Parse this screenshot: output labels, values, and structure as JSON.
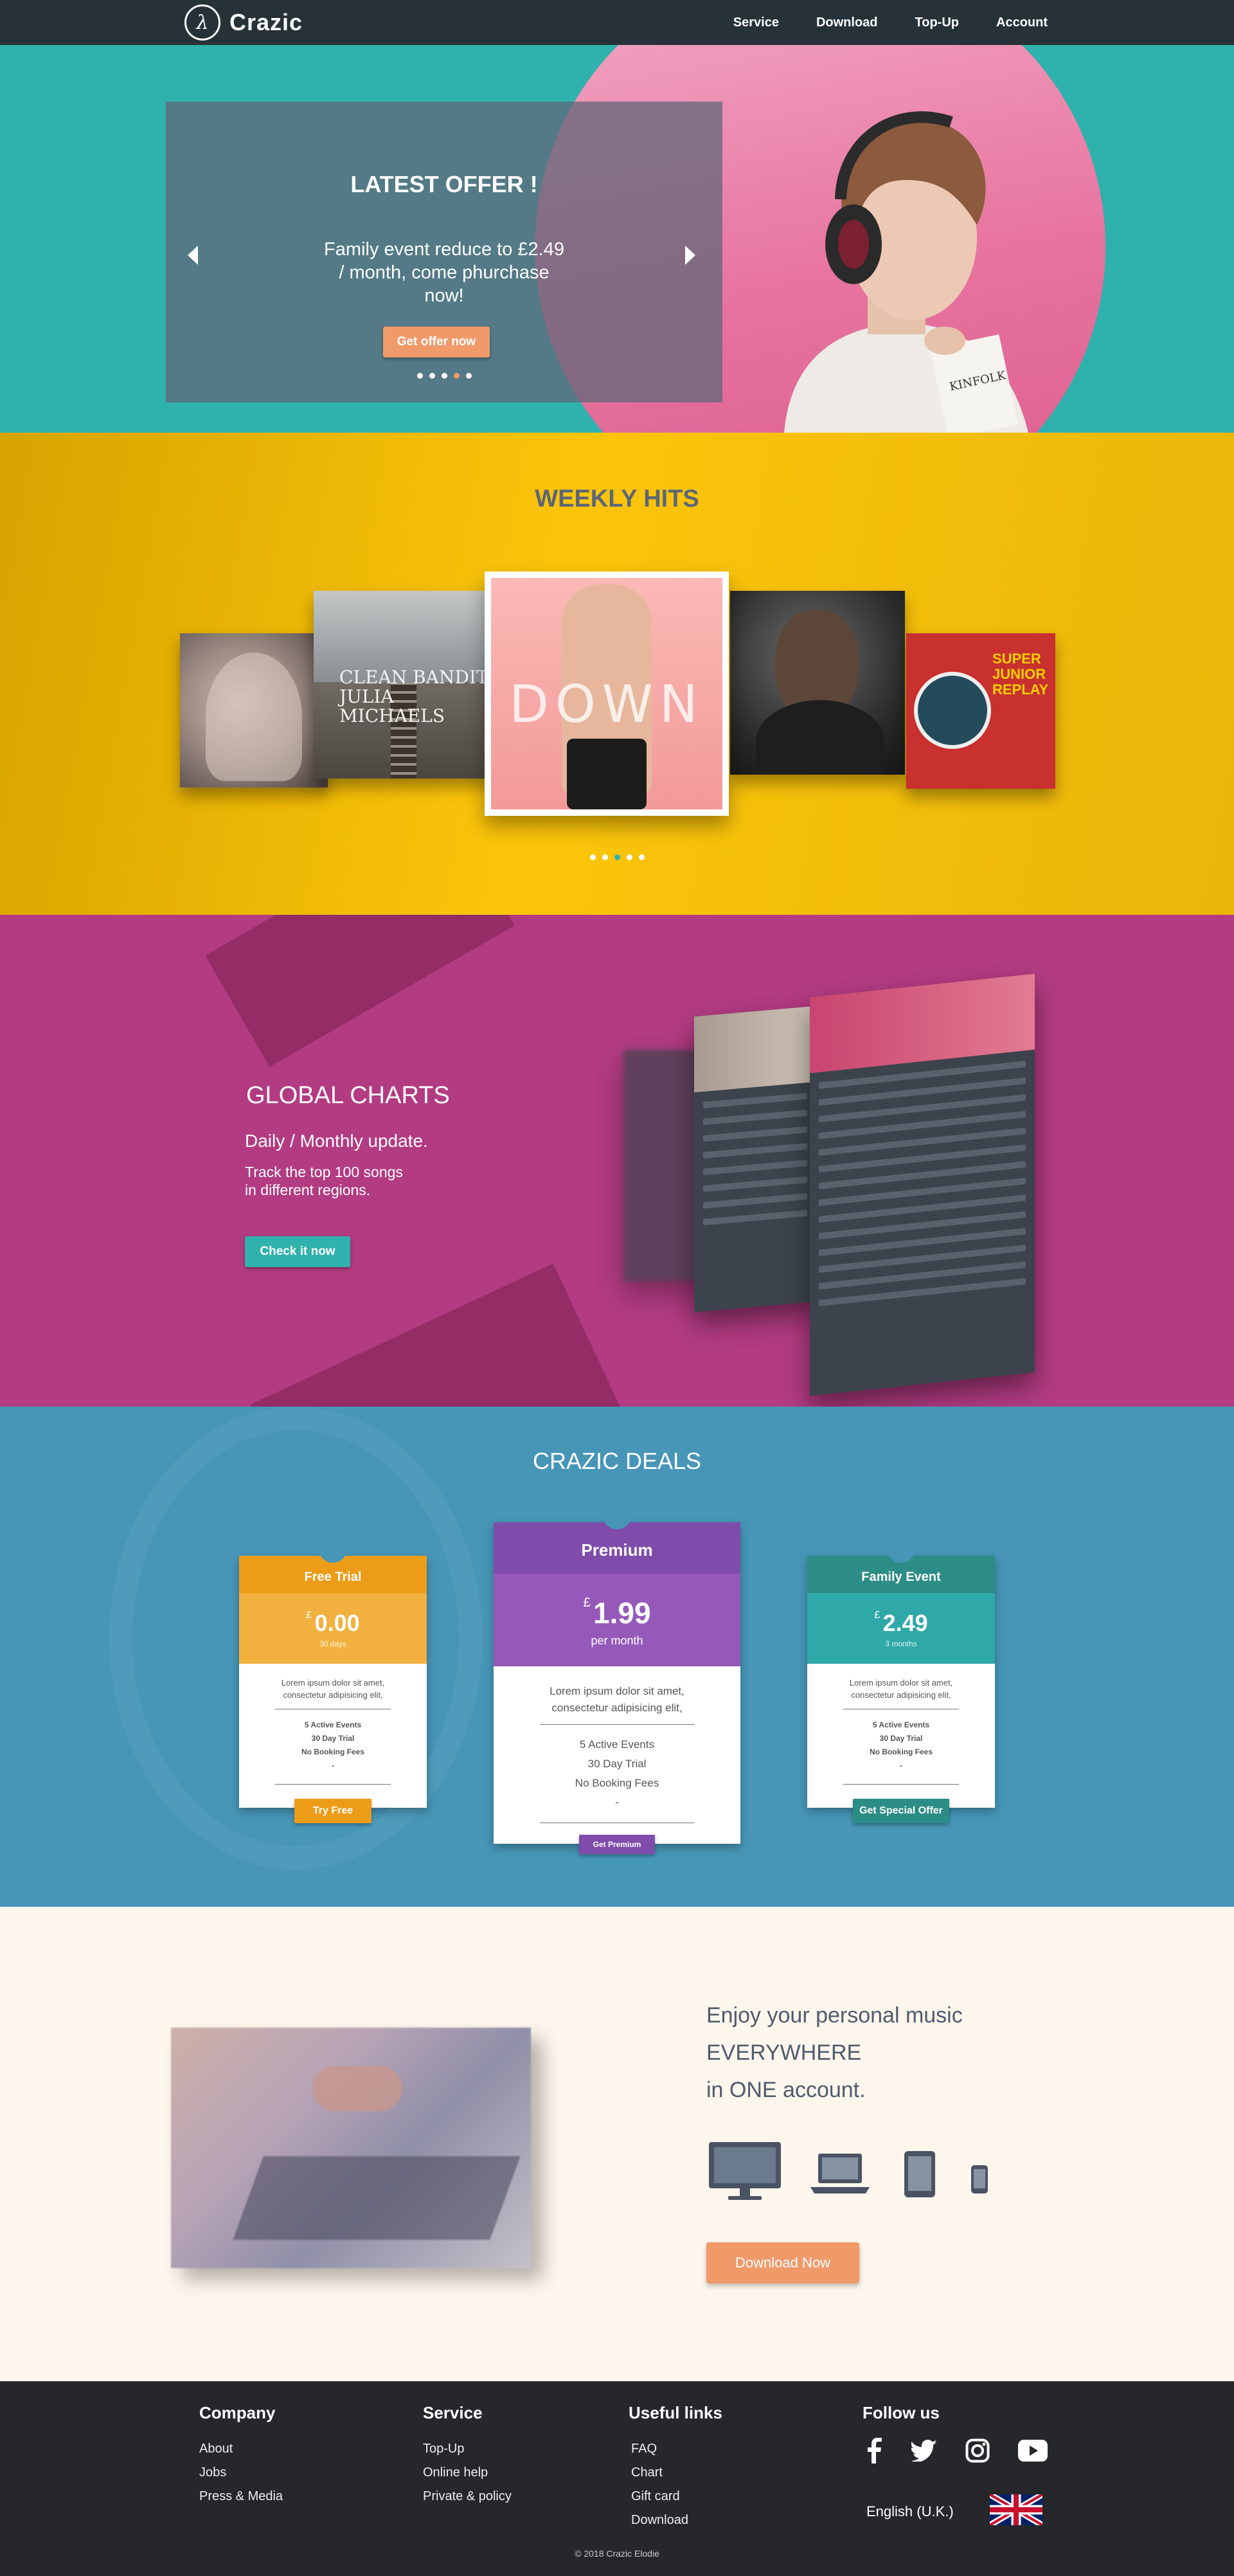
{
  "nav": {
    "logo_glyph": "λ",
    "brand": "Crazic",
    "links": [
      "Service",
      "Download",
      "Top-Up",
      "Account"
    ]
  },
  "hero": {
    "title": "LATEST OFFER !",
    "text": "Family event reduce to £2.49 / month, come phurchase now!",
    "button": "Get offer now",
    "slides": 5,
    "active_slide": 4
  },
  "hits": {
    "title": "WEEKLY HITS",
    "albums": [
      {
        "cover_text": ""
      },
      {
        "cover_text": "CLEAN BANDIT JULIA MICHAELS"
      },
      {
        "cover_text": "DOWN"
      },
      {
        "cover_text": ""
      },
      {
        "cover_text": "SUPER JUNIOR REPLAY"
      }
    ],
    "active_slide": 3
  },
  "charts": {
    "title": "GLOBAL CHARTS",
    "subtitle": "Daily / Monthly update.",
    "line1": "Track the top 100 songs",
    "line2": "in different regions.",
    "button": "Check it now"
  },
  "deals": {
    "title": "CRAZIC DEALS",
    "plans": [
      {
        "name": "Free Trial",
        "currency": "£",
        "price": "0.00",
        "period": "30 days",
        "desc1": "Lorem ipsum dolor sit amet,",
        "desc2": "consectetur adipisicing elit,",
        "features": [
          "5 Active Events",
          "30 Day Trial",
          "No Booking Fees",
          "-"
        ],
        "button": "Try Free",
        "head_color": "#ed9c18",
        "price_color": "#f2b13e",
        "btn_color": "#ed9c18"
      },
      {
        "name": "Premium",
        "currency": "£",
        "price": "1.99",
        "period": "per month",
        "desc1": "Lorem ipsum dolor sit amet,",
        "desc2": "consectetur adipisicing elit,",
        "features": [
          "5 Active Events",
          "30 Day Trial",
          "No Booking Fees",
          "-"
        ],
        "button": "Get Premium",
        "head_color": "#7f4cab",
        "price_color": "#9559ba",
        "btn_color": "#7f4cab"
      },
      {
        "name": "Family Event",
        "currency": "£",
        "price": "2.49",
        "period": "3 months",
        "desc1": "Lorem ipsum dolor sit amet,",
        "desc2": "consectetur adipisicing elit,",
        "features": [
          "5 Active Events",
          "30 Day Trial",
          "No Booking Fees",
          "-"
        ],
        "button": "Get Special Offer",
        "head_color": "#2c8c86",
        "price_color": "#2fa8a9",
        "btn_color": "#2c8c86"
      }
    ]
  },
  "everywhere": {
    "line1": "Enjoy your personal music",
    "line2": "EVERYWHERE",
    "line3": "in ONE account.",
    "devices": [
      "desktop-icon",
      "laptop-icon",
      "tablet-icon",
      "phone-icon"
    ],
    "button": "Download Now"
  },
  "footer": {
    "columns": [
      {
        "title": "Company",
        "links": [
          "About",
          "Jobs",
          "Press & Media"
        ]
      },
      {
        "title": "Service",
        "links": [
          "Top-Up",
          "Online help",
          "Private & policy"
        ]
      },
      {
        "title": "Useful links",
        "links": [
          "FAQ",
          "Chart",
          "Gift card",
          "Download"
        ]
      }
    ],
    "follow_title": "Follow us",
    "social": [
      "facebook-icon",
      "twitter-icon",
      "instagram-icon",
      "youtube-icon"
    ],
    "language": "English (U.K.)",
    "copyright": "© 2018 Crazic Elodie"
  },
  "colors": {
    "nav": "#263238",
    "teal": "#2fb1ad",
    "yellow": "#fcc50a",
    "magenta": "#b23b82",
    "blue": "#4796b8",
    "cream": "#fdf6ec",
    "orange": "#f09a6a",
    "footer": "#25272b"
  }
}
